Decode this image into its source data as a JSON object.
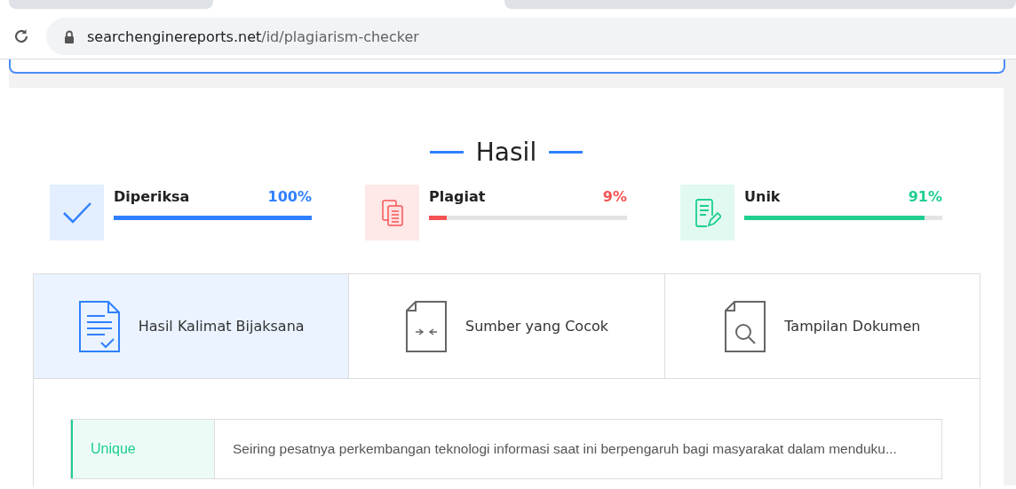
{
  "browser": {
    "url_host": "searchenginereports.net",
    "url_path": "/id/plagiarism-checker"
  },
  "heading": "Hasil",
  "stats": [
    {
      "kind": "check",
      "label": "Diperiksa",
      "value": "100%",
      "level": 1,
      "color": "#2f80ff"
    },
    {
      "kind": "copy",
      "label": "Plagiat",
      "value": "9%",
      "level": 0.09,
      "color": "#f65454"
    },
    {
      "kind": "edit",
      "label": "Unik",
      "value": "91%",
      "level": 0.91,
      "color": "#1fcf8f"
    }
  ],
  "tabs": [
    {
      "kind": "list",
      "label": "Hasil Kalimat Bijaksana",
      "selected": true
    },
    {
      "kind": "compare",
      "label": "Sumber yang Cocok",
      "selected": false
    },
    {
      "kind": "search",
      "label": "Tampilan Dokumen",
      "selected": false
    }
  ],
  "results": [
    {
      "status": "Unique",
      "color": "#1fcf8f",
      "text": "Seiring pesatnya perkembangan teknologi informasi saat ini berpengaruh bagi masyarakat dalam menduku..."
    }
  ]
}
